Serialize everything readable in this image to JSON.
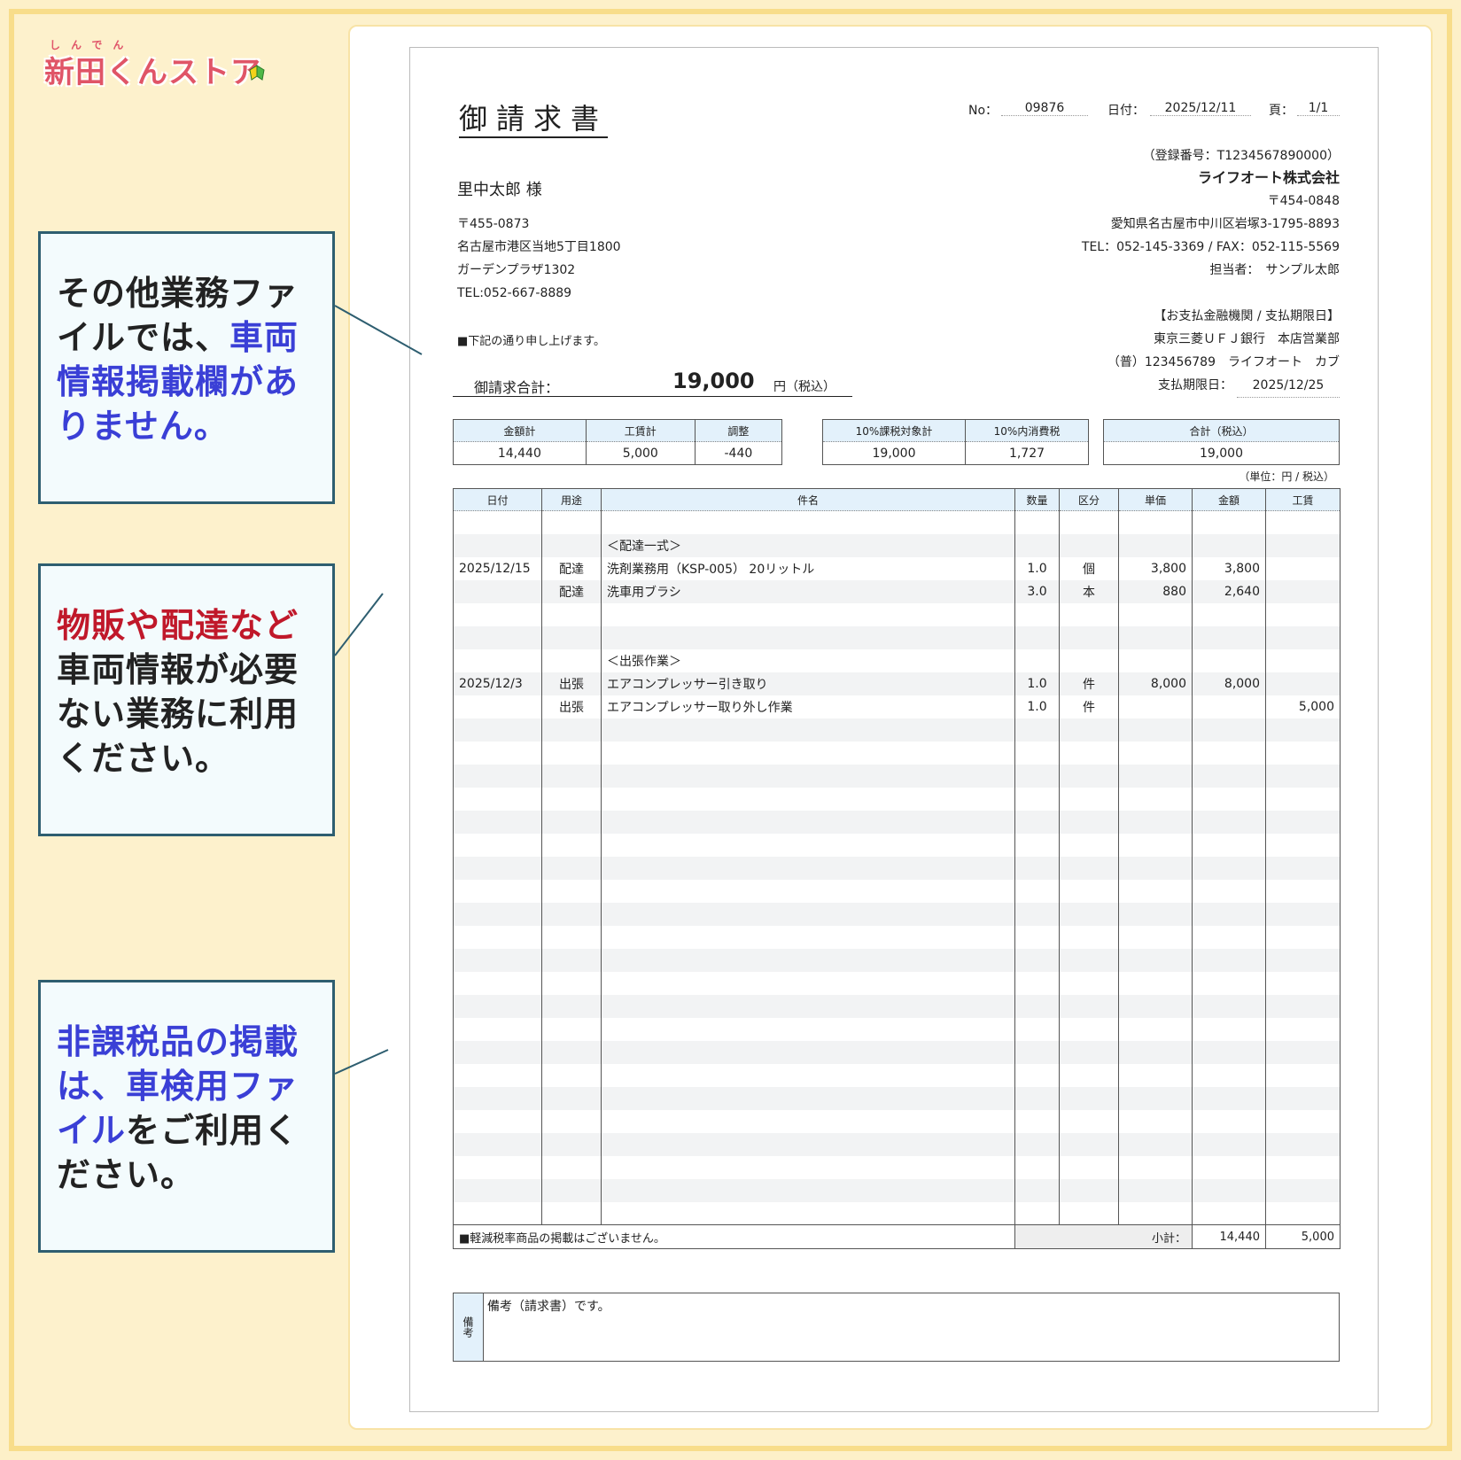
{
  "logo": {
    "ruby": "しんでん",
    "text": "新田くんストア"
  },
  "notes": {
    "note1": {
      "a": "その他業務ファイルでは、",
      "b": "車両情報掲載欄がありません。"
    },
    "note2": {
      "a": "物販や配達など",
      "b": "車両情報が必要ない業務に利用ください。"
    },
    "note3": {
      "a": "非課税品の掲載は、車検用ファイル",
      "b": "をご利用ください。"
    }
  },
  "invoice": {
    "title": "御請求書",
    "no_label": "No：",
    "no_value": "09876",
    "date_label": "日付：",
    "date_value": "2025/12/11",
    "page_label": "頁：",
    "page_value": "1/1",
    "customer": {
      "name": "里中太郎 様",
      "zip": "〒455-0873",
      "address1": "名古屋市港区当地5丁目1800",
      "address2": "ガーデンプラザ1302",
      "tel": "TEL:052-667-8889"
    },
    "issuer": {
      "reg": "（登録番号：T1234567890000）",
      "company": "ライフオート株式会社",
      "zip": "〒454-0848",
      "address": "愛知県名古屋市中川区岩塚3-1795-8893",
      "telfax": "TEL：052-145-3369 / FAX：052-115-5569",
      "staff": "担当者：　サンプル太郎"
    },
    "bank": {
      "heading": "【お支払金融機関 / 支払期限日】",
      "bank_name": "東京三菱ＵＦＪ銀行　本店営業部",
      "account": "（普）123456789　ライフオート　カブ",
      "due_label": "支払期限日：",
      "due_value": "2025/12/25"
    },
    "lead": "■下記の通り申し上げます。",
    "total_label": "御請求合計：",
    "total_value": "19,000",
    "total_unit": "円（税込）",
    "summary1": {
      "h1": "金額計",
      "h2": "工賃計",
      "h3": "調整",
      "v1": "14,440",
      "v2": "5,000",
      "v3": "-440"
    },
    "summary2": {
      "h1": "10%課税対象計",
      "h2": "10%内消費税",
      "v1": "19,000",
      "v2": "1,727"
    },
    "summary3": {
      "h1": "合計（税込）",
      "v1": "19,000"
    },
    "unit_note": "（単位：円 / 税込）",
    "columns": [
      "日付",
      "用途",
      "件名",
      "数量",
      "区分",
      "単価",
      "金額",
      "工賃"
    ],
    "rows": [
      [
        "",
        "",
        "",
        "",
        "",
        "",
        "",
        ""
      ],
      [
        "",
        "",
        "＜配達一式＞",
        "",
        "",
        "",
        "",
        ""
      ],
      [
        "2025/12/15",
        "配達",
        "洗剤業務用（KSP-005） 20リットル",
        "1.0",
        "個",
        "3,800",
        "3,800",
        ""
      ],
      [
        "",
        "配達",
        "洗車用ブラシ",
        "3.0",
        "本",
        "880",
        "2,640",
        ""
      ],
      [
        "",
        "",
        "",
        "",
        "",
        "",
        "",
        ""
      ],
      [
        "",
        "",
        "",
        "",
        "",
        "",
        "",
        ""
      ],
      [
        "",
        "",
        "＜出張作業＞",
        "",
        "",
        "",
        "",
        ""
      ],
      [
        "2025/12/3",
        "出張",
        "エアコンプレッサー引き取り",
        "1.0",
        "件",
        "8,000",
        "8,000",
        ""
      ],
      [
        "",
        "出張",
        "エアコンプレッサー取り外し作業",
        "1.0",
        "件",
        "",
        "",
        "5,000"
      ]
    ],
    "footer": {
      "note": "■軽減税率商品の掲載はございません。",
      "subtotal_label": "小計：",
      "subtotal_amount": "14,440",
      "subtotal_labor": "5,000"
    },
    "remarks": {
      "label": "備考",
      "text": "備考（請求書）です。"
    }
  }
}
